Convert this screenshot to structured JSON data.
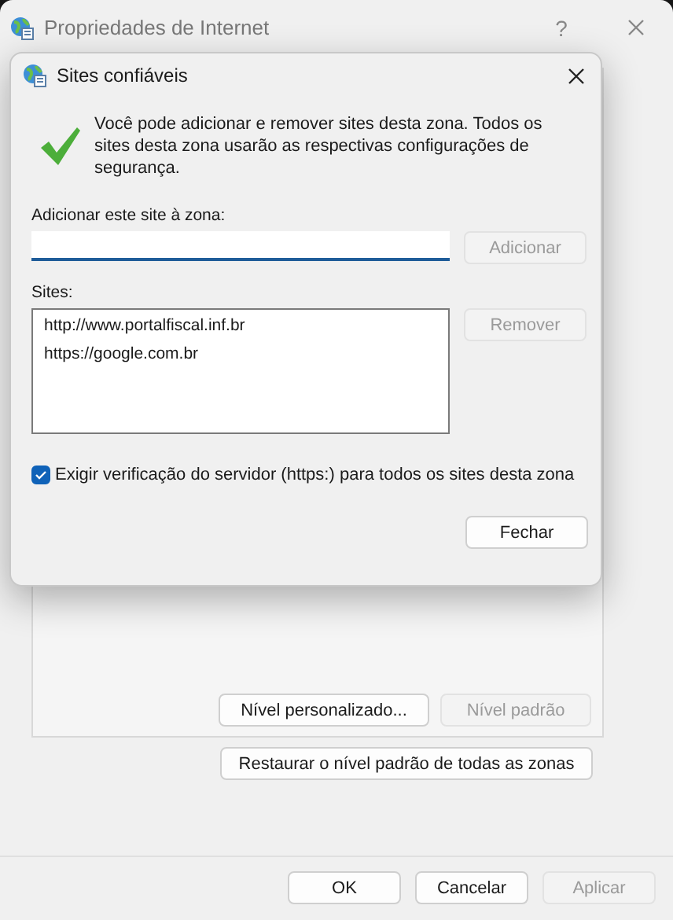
{
  "window": {
    "title": "Propriedades de Internet",
    "help": "?"
  },
  "zone_buttons": [
    {
      "label": "Nível personalizado...",
      "disabled": false
    },
    {
      "label": "Nível padrão",
      "disabled": true
    }
  ],
  "restore_button": {
    "label": "Restaurar o nível padrão de todas as zonas",
    "disabled": false
  },
  "footer_buttons": [
    {
      "label": "OK",
      "disabled": false
    },
    {
      "label": "Cancelar",
      "disabled": false
    },
    {
      "label": "Aplicar",
      "disabled": true
    }
  ],
  "dialog": {
    "title": "Sites confiáveis",
    "message": "Você pode adicionar e remover sites desta zona. Todos os sites desta zona usarão as respectivas configurações de segurança.",
    "add_label": "Adicionar este site à zona:",
    "add_button": {
      "label": "Adicionar",
      "disabled": true
    },
    "sites_label": "Sites:",
    "sites": [
      {
        "url": "http://www.portalfiscal.inf.br",
        "selected": false
      },
      {
        "url": "https://google.com.br",
        "selected": false
      }
    ],
    "remove_button": {
      "label": "Remover",
      "disabled": true
    },
    "https_check": {
      "label": "Exigir verificação do servidor (https:) para todos os sites desta zona",
      "checked": true
    },
    "close_button": {
      "label": "Fechar",
      "disabled": false
    }
  }
}
